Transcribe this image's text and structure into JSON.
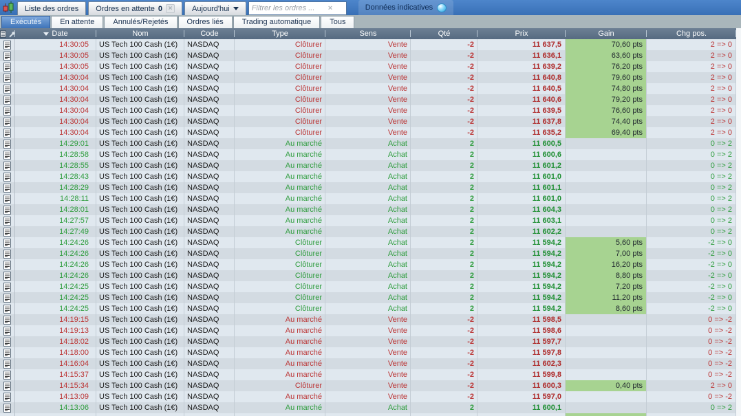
{
  "colors": {
    "topbar_blue": "#3f77bd",
    "active_tab_blue": "#3e73b8",
    "header_slate": "#5d7188",
    "gain_green_bg": "#a7d391",
    "sell_red": "#bb3434",
    "buy_green": "#2d9c3c",
    "row_light": "#e0e8ef",
    "row_dark": "#d3dbe2"
  },
  "topbar": {
    "window_tabs": [
      {
        "label": "Liste des ordres"
      },
      {
        "label": "Ordres en attente",
        "badge": "0"
      },
      {
        "label": "Aujourd'hui"
      }
    ],
    "filter": {
      "placeholder": "Filtrer les ordres ...",
      "value": ""
    },
    "indicative_label": "Données indicatives"
  },
  "subtabs": {
    "items": [
      {
        "label": "Exécutés",
        "active": true
      },
      {
        "label": "En attente",
        "active": false
      },
      {
        "label": "Annulés/Rejetés",
        "active": false
      },
      {
        "label": "Ordres liés",
        "active": false
      },
      {
        "label": "Trading automatique",
        "active": false
      },
      {
        "label": "Tous",
        "active": false
      }
    ]
  },
  "table": {
    "columns": {
      "date": "Date",
      "nom": "Nom",
      "code": "Code",
      "type": "Type",
      "sens": "Sens",
      "qte": "Qté",
      "prix": "Prix",
      "gain": "Gain",
      "chg": "Chg pos."
    },
    "rows": [
      {
        "time": "14:30:05",
        "name": "US Tech 100 Cash (1€)",
        "code": "NASDAQ",
        "type": "Clôturer",
        "sens": "Vente",
        "qty": "-2",
        "price": "11 637,5",
        "gain": "70,60 pts",
        "chg": "2 => 0",
        "side": "sell"
      },
      {
        "time": "14:30:05",
        "name": "US Tech 100 Cash (1€)",
        "code": "NASDAQ",
        "type": "Clôturer",
        "sens": "Vente",
        "qty": "-2",
        "price": "11 636,1",
        "gain": "63,60 pts",
        "chg": "2 => 0",
        "side": "sell"
      },
      {
        "time": "14:30:05",
        "name": "US Tech 100 Cash (1€)",
        "code": "NASDAQ",
        "type": "Clôturer",
        "sens": "Vente",
        "qty": "-2",
        "price": "11 639,2",
        "gain": "76,20 pts",
        "chg": "2 => 0",
        "side": "sell"
      },
      {
        "time": "14:30:04",
        "name": "US Tech 100 Cash (1€)",
        "code": "NASDAQ",
        "type": "Clôturer",
        "sens": "Vente",
        "qty": "-2",
        "price": "11 640,8",
        "gain": "79,60 pts",
        "chg": "2 => 0",
        "side": "sell"
      },
      {
        "time": "14:30:04",
        "name": "US Tech 100 Cash (1€)",
        "code": "NASDAQ",
        "type": "Clôturer",
        "sens": "Vente",
        "qty": "-2",
        "price": "11 640,5",
        "gain": "74,80 pts",
        "chg": "2 => 0",
        "side": "sell"
      },
      {
        "time": "14:30:04",
        "name": "US Tech 100 Cash (1€)",
        "code": "NASDAQ",
        "type": "Clôturer",
        "sens": "Vente",
        "qty": "-2",
        "price": "11 640,6",
        "gain": "79,20 pts",
        "chg": "2 => 0",
        "side": "sell"
      },
      {
        "time": "14:30:04",
        "name": "US Tech 100 Cash (1€)",
        "code": "NASDAQ",
        "type": "Clôturer",
        "sens": "Vente",
        "qty": "-2",
        "price": "11 639,5",
        "gain": "76,60 pts",
        "chg": "2 => 0",
        "side": "sell"
      },
      {
        "time": "14:30:04",
        "name": "US Tech 100 Cash (1€)",
        "code": "NASDAQ",
        "type": "Clôturer",
        "sens": "Vente",
        "qty": "-2",
        "price": "11 637,8",
        "gain": "74,40 pts",
        "chg": "2 => 0",
        "side": "sell"
      },
      {
        "time": "14:30:04",
        "name": "US Tech 100 Cash (1€)",
        "code": "NASDAQ",
        "type": "Clôturer",
        "sens": "Vente",
        "qty": "-2",
        "price": "11 635,2",
        "gain": "69,40 pts",
        "chg": "2 => 0",
        "side": "sell"
      },
      {
        "time": "14:29:01",
        "name": "US Tech 100 Cash (1€)",
        "code": "NASDAQ",
        "type": "Au marché",
        "sens": "Achat",
        "qty": "2",
        "price": "11 600,5",
        "gain": "",
        "chg": "0 => 2",
        "side": "buy"
      },
      {
        "time": "14:28:58",
        "name": "US Tech 100 Cash (1€)",
        "code": "NASDAQ",
        "type": "Au marché",
        "sens": "Achat",
        "qty": "2",
        "price": "11 600,6",
        "gain": "",
        "chg": "0 => 2",
        "side": "buy"
      },
      {
        "time": "14:28:55",
        "name": "US Tech 100 Cash (1€)",
        "code": "NASDAQ",
        "type": "Au marché",
        "sens": "Achat",
        "qty": "2",
        "price": "11 601,2",
        "gain": "",
        "chg": "0 => 2",
        "side": "buy"
      },
      {
        "time": "14:28:43",
        "name": "US Tech 100 Cash (1€)",
        "code": "NASDAQ",
        "type": "Au marché",
        "sens": "Achat",
        "qty": "2",
        "price": "11 601,0",
        "gain": "",
        "chg": "0 => 2",
        "side": "buy"
      },
      {
        "time": "14:28:29",
        "name": "US Tech 100 Cash (1€)",
        "code": "NASDAQ",
        "type": "Au marché",
        "sens": "Achat",
        "qty": "2",
        "price": "11 601,1",
        "gain": "",
        "chg": "0 => 2",
        "side": "buy"
      },
      {
        "time": "14:28:11",
        "name": "US Tech 100 Cash (1€)",
        "code": "NASDAQ",
        "type": "Au marché",
        "sens": "Achat",
        "qty": "2",
        "price": "11 601,0",
        "gain": "",
        "chg": "0 => 2",
        "side": "buy"
      },
      {
        "time": "14:28:01",
        "name": "US Tech 100 Cash (1€)",
        "code": "NASDAQ",
        "type": "Au marché",
        "sens": "Achat",
        "qty": "2",
        "price": "11 604,3",
        "gain": "",
        "chg": "0 => 2",
        "side": "buy"
      },
      {
        "time": "14:27:57",
        "name": "US Tech 100 Cash (1€)",
        "code": "NASDAQ",
        "type": "Au marché",
        "sens": "Achat",
        "qty": "2",
        "price": "11 603,1",
        "gain": "",
        "chg": "0 => 2",
        "side": "buy"
      },
      {
        "time": "14:27:49",
        "name": "US Tech 100 Cash (1€)",
        "code": "NASDAQ",
        "type": "Au marché",
        "sens": "Achat",
        "qty": "2",
        "price": "11 602,2",
        "gain": "",
        "chg": "0 => 2",
        "side": "buy"
      },
      {
        "time": "14:24:26",
        "name": "US Tech 100 Cash (1€)",
        "code": "NASDAQ",
        "type": "Clôturer",
        "sens": "Achat",
        "qty": "2",
        "price": "11 594,2",
        "gain": "5,60 pts",
        "chg": "-2 => 0",
        "side": "buy"
      },
      {
        "time": "14:24:26",
        "name": "US Tech 100 Cash (1€)",
        "code": "NASDAQ",
        "type": "Clôturer",
        "sens": "Achat",
        "qty": "2",
        "price": "11 594,2",
        "gain": "7,00 pts",
        "chg": "-2 => 0",
        "side": "buy"
      },
      {
        "time": "14:24:26",
        "name": "US Tech 100 Cash (1€)",
        "code": "NASDAQ",
        "type": "Clôturer",
        "sens": "Achat",
        "qty": "2",
        "price": "11 594,2",
        "gain": "16,20 pts",
        "chg": "-2 => 0",
        "side": "buy"
      },
      {
        "time": "14:24:26",
        "name": "US Tech 100 Cash (1€)",
        "code": "NASDAQ",
        "type": "Clôturer",
        "sens": "Achat",
        "qty": "2",
        "price": "11 594,2",
        "gain": "8,80 pts",
        "chg": "-2 => 0",
        "side": "buy"
      },
      {
        "time": "14:24:25",
        "name": "US Tech 100 Cash (1€)",
        "code": "NASDAQ",
        "type": "Clôturer",
        "sens": "Achat",
        "qty": "2",
        "price": "11 594,2",
        "gain": "7,20 pts",
        "chg": "-2 => 0",
        "side": "buy"
      },
      {
        "time": "14:24:25",
        "name": "US Tech 100 Cash (1€)",
        "code": "NASDAQ",
        "type": "Clôturer",
        "sens": "Achat",
        "qty": "2",
        "price": "11 594,2",
        "gain": "11,20 pts",
        "chg": "-2 => 0",
        "side": "buy"
      },
      {
        "time": "14:24:25",
        "name": "US Tech 100 Cash (1€)",
        "code": "NASDAQ",
        "type": "Clôturer",
        "sens": "Achat",
        "qty": "2",
        "price": "11 594,2",
        "gain": "8,60 pts",
        "chg": "-2 => 0",
        "side": "buy"
      },
      {
        "time": "14:19:15",
        "name": "US Tech 100 Cash (1€)",
        "code": "NASDAQ",
        "type": "Au marché",
        "sens": "Vente",
        "qty": "-2",
        "price": "11 598,5",
        "gain": "",
        "chg": "0 => -2",
        "side": "sell"
      },
      {
        "time": "14:19:13",
        "name": "US Tech 100 Cash (1€)",
        "code": "NASDAQ",
        "type": "Au marché",
        "sens": "Vente",
        "qty": "-2",
        "price": "11 598,6",
        "gain": "",
        "chg": "0 => -2",
        "side": "sell"
      },
      {
        "time": "14:18:02",
        "name": "US Tech 100 Cash (1€)",
        "code": "NASDAQ",
        "type": "Au marché",
        "sens": "Vente",
        "qty": "-2",
        "price": "11 597,7",
        "gain": "",
        "chg": "0 => -2",
        "side": "sell"
      },
      {
        "time": "14:18:00",
        "name": "US Tech 100 Cash (1€)",
        "code": "NASDAQ",
        "type": "Au marché",
        "sens": "Vente",
        "qty": "-2",
        "price": "11 597,8",
        "gain": "",
        "chg": "0 => -2",
        "side": "sell"
      },
      {
        "time": "14:16:04",
        "name": "US Tech 100 Cash (1€)",
        "code": "NASDAQ",
        "type": "Au marché",
        "sens": "Vente",
        "qty": "-2",
        "price": "11 602,3",
        "gain": "",
        "chg": "0 => -2",
        "side": "sell"
      },
      {
        "time": "14:15:37",
        "name": "US Tech 100 Cash (1€)",
        "code": "NASDAQ",
        "type": "Au marché",
        "sens": "Vente",
        "qty": "-2",
        "price": "11 599,8",
        "gain": "",
        "chg": "0 => -2",
        "side": "sell"
      },
      {
        "time": "14:15:34",
        "name": "US Tech 100 Cash (1€)",
        "code": "NASDAQ",
        "type": "Clôturer",
        "sens": "Vente",
        "qty": "-2",
        "price": "11 600,3",
        "gain": "0,40 pts",
        "chg": "2 => 0",
        "side": "sell"
      },
      {
        "time": "14:13:09",
        "name": "US Tech 100 Cash (1€)",
        "code": "NASDAQ",
        "type": "Au marché",
        "sens": "Vente",
        "qty": "-2",
        "price": "11 597,0",
        "gain": "",
        "chg": "0 => -2",
        "side": "sell"
      },
      {
        "time": "14:13:06",
        "name": "US Tech 100 Cash (1€)",
        "code": "NASDAQ",
        "type": "Au marché",
        "sens": "Achat",
        "qty": "2",
        "price": "11 600,1",
        "gain": "",
        "chg": "0 => 2",
        "side": "buy"
      }
    ]
  }
}
